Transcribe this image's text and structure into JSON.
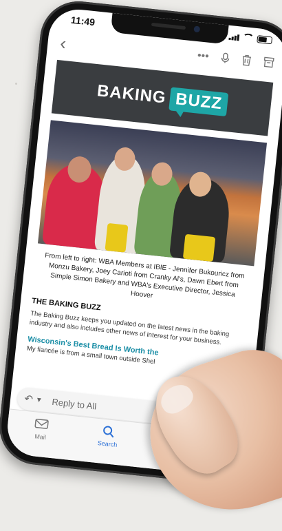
{
  "status_bar": {
    "time": "11:49"
  },
  "toolbar": {
    "back_icon": "chevron-left-icon",
    "more_icon": "more-icon",
    "mic_icon": "microphone-icon",
    "trash_icon": "trash-icon",
    "archive_icon": "archive-icon"
  },
  "email": {
    "banner": {
      "word1": "BAKING",
      "word2": "BUZZ"
    },
    "caption": "From left to right: WBA Members at IBIE - Jennifer Bukouricz from Monzu Bakery, Joey Carioti from Cranky Al's, Dawn Ebert from Simple Simon Bakery and WBA's Executive Director, Jessica Hoover",
    "section_title": "THE BAKING BUZZ",
    "section_body": "The Baking Buzz keeps you updated on the latest news in the baking industry and also includes other news of interest for your business.",
    "article_title": "Wisconsin's Best Bread Is Worth the",
    "article_snippet": "My fiancée is from a small town outside Shel"
  },
  "reply": {
    "placeholder": "Reply to All"
  },
  "tabbar": {
    "items": [
      {
        "label": "Mail",
        "icon": "mail-icon"
      },
      {
        "label": "Search",
        "icon": "search-icon"
      }
    ],
    "active": "Search"
  },
  "colors": {
    "accent": "#1ea6a6",
    "link": "#1b8ea6",
    "tab_active": "#2a6fd6",
    "banner_bg": "#3a3d40"
  }
}
